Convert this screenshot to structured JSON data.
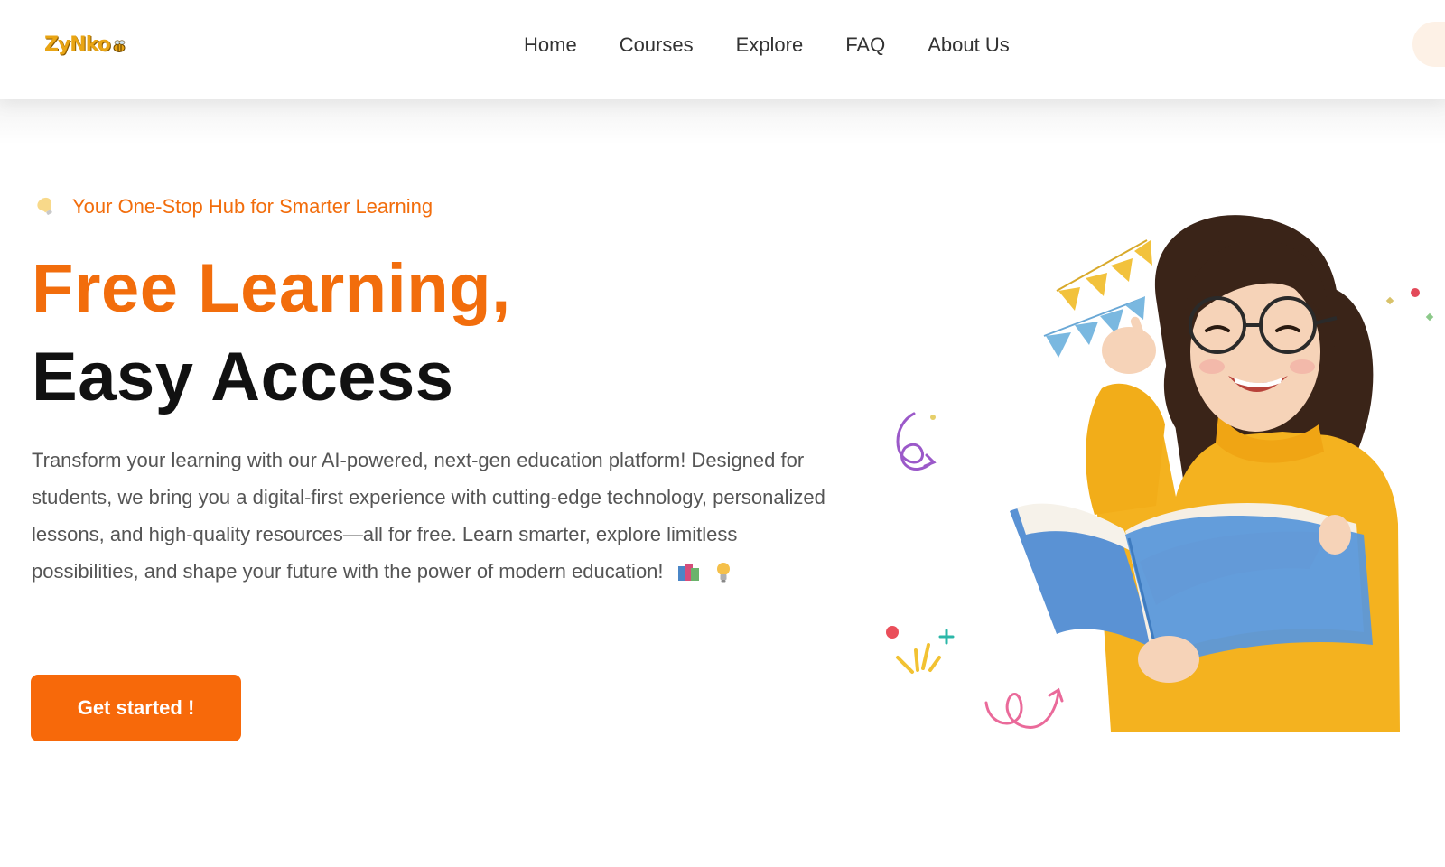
{
  "header": {
    "logo_text": "ZyNko",
    "nav": [
      {
        "label": "Home"
      },
      {
        "label": "Courses"
      },
      {
        "label": "Explore"
      },
      {
        "label": "FAQ"
      },
      {
        "label": "About Us"
      }
    ]
  },
  "hero": {
    "tagline": "Your One-Stop Hub for Smarter Learning",
    "headline_line1": "Free Learning,",
    "headline_line2": "Easy Access",
    "description": "Transform your learning with our AI-powered, next-gen education platform! Designed for students, we bring you a digital-first experience with cutting-edge technology, personalized lessons, and high-quality resources—all for free. Learn smarter, explore limitless possibilities, and shape your future with the power of modern education!",
    "description_icons": [
      "books-icon",
      "lightbulb-icon"
    ],
    "cta_label": "Get started !",
    "illustration": "girl-reading-book-illustration"
  },
  "colors": {
    "accent": "#f26d0c",
    "cta": "#f7690a",
    "text_dark": "#111111",
    "text_body": "#555555"
  }
}
